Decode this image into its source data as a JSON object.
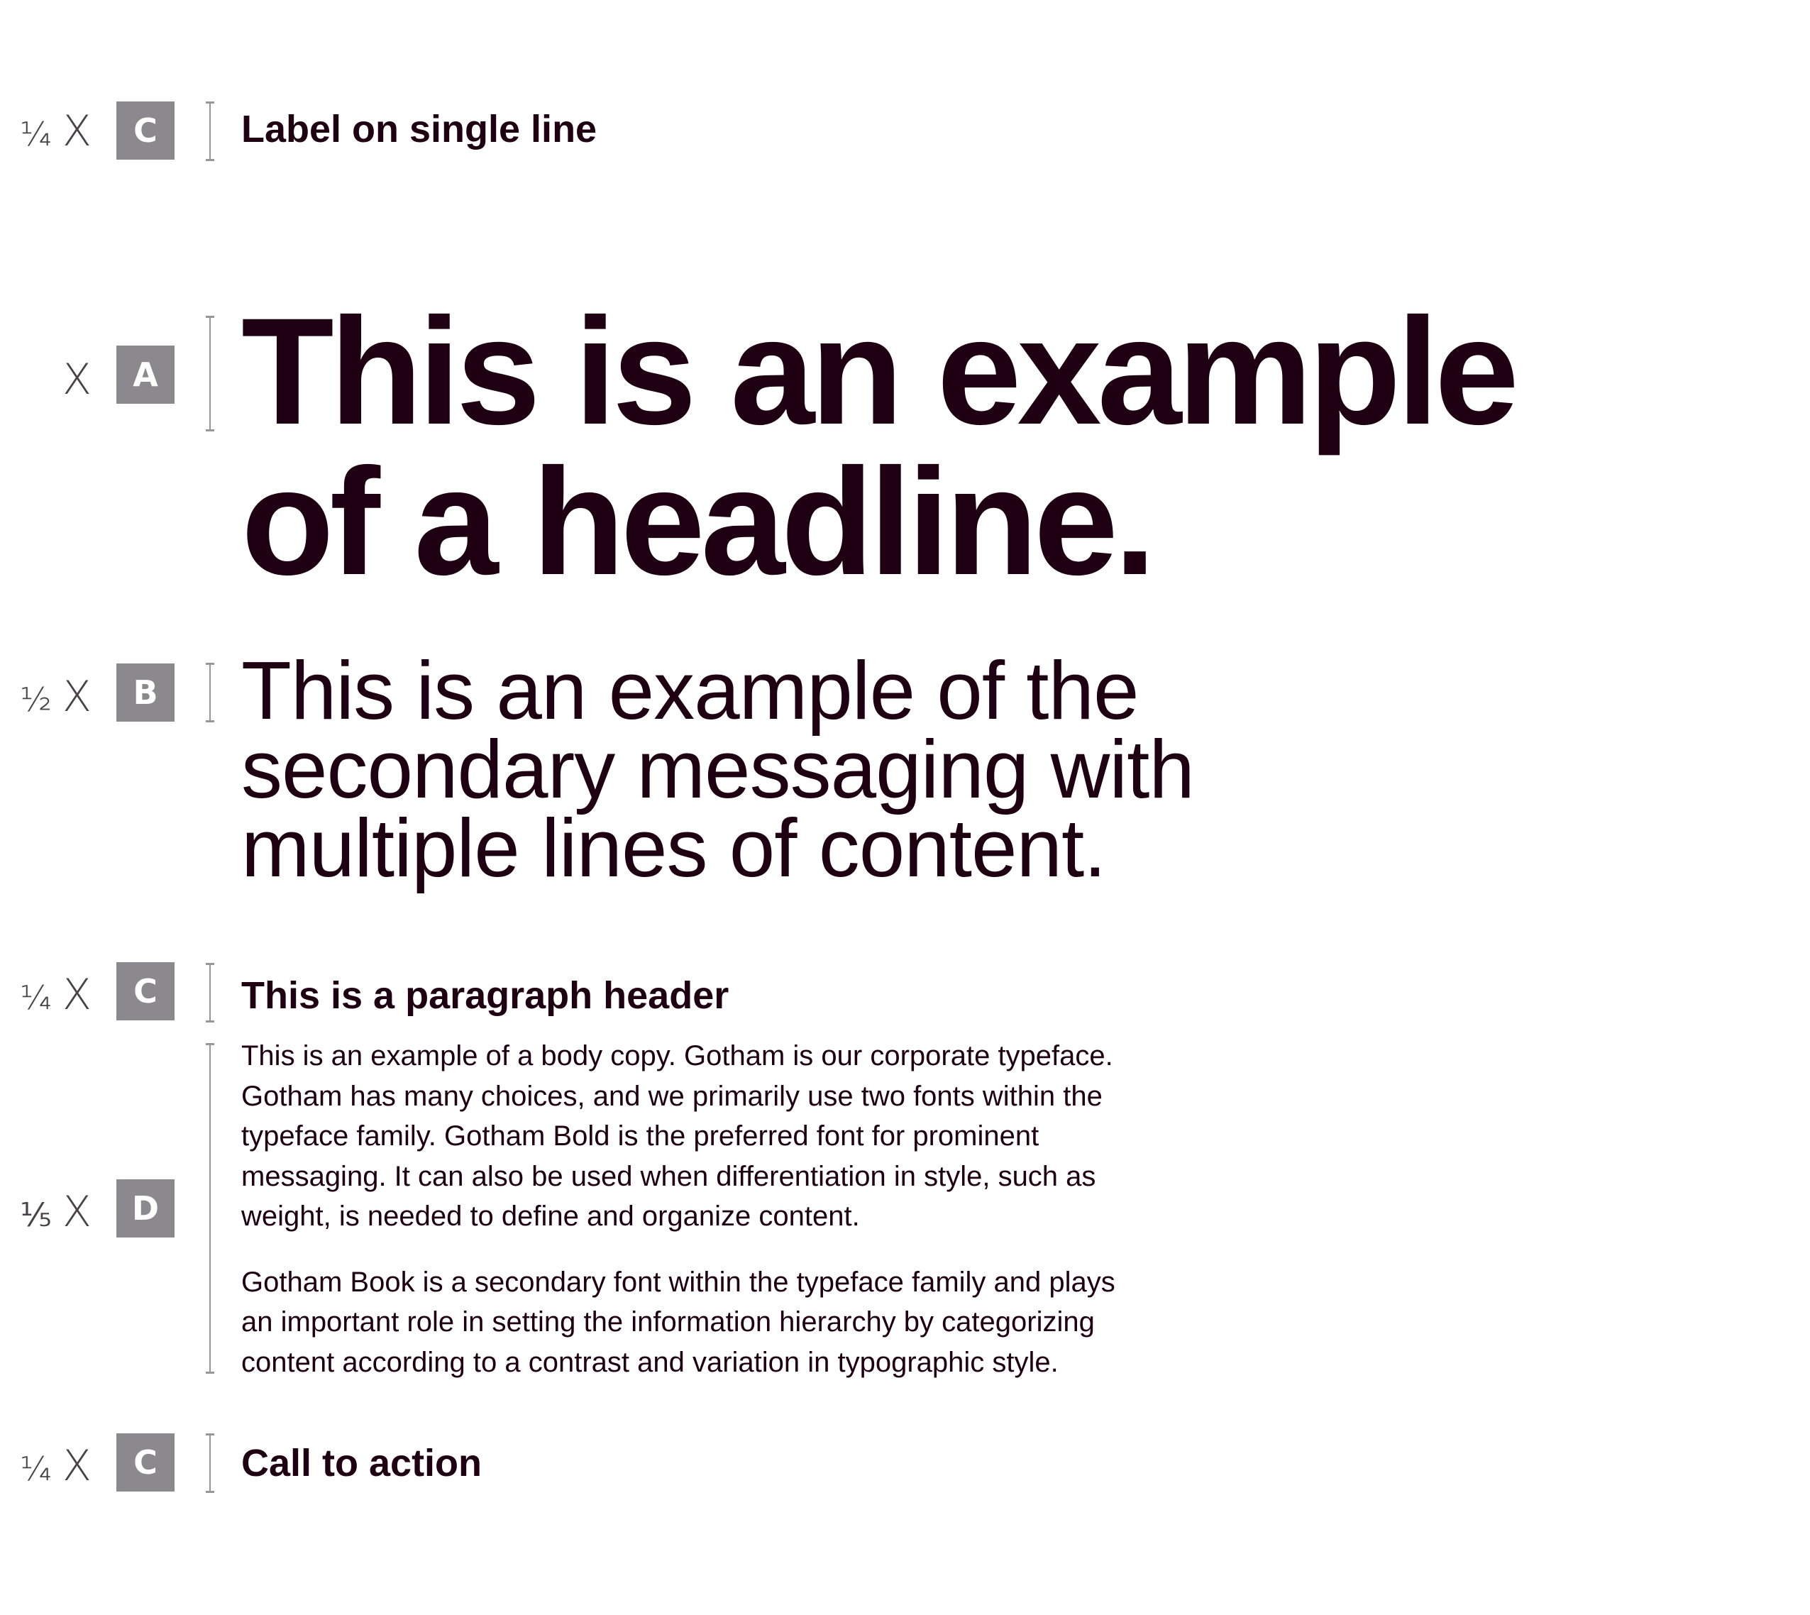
{
  "rows": [
    {
      "ratio": "¼",
      "multiplier": "X",
      "style_letter": "C",
      "text": "Label on single line"
    },
    {
      "ratio": "",
      "multiplier": "X",
      "style_letter": "A",
      "lines": [
        "This is an example",
        "of a headline."
      ]
    },
    {
      "ratio": "½",
      "multiplier": "X",
      "style_letter": "B",
      "lines": [
        "This is an example of the",
        "secondary messaging with",
        "multiple lines of content."
      ]
    },
    {
      "ratio": "¼",
      "multiplier": "X",
      "style_letter": "C",
      "text": "This is a paragraph header"
    },
    {
      "ratio": "⅕",
      "multiplier": "X",
      "style_letter": "D",
      "paragraphs": [
        [
          "This is an example of a body copy. Gotham is our corporate typeface.",
          "Gotham has many choices, and we primarily use two fonts within the",
          "typeface family. Gotham Bold is the preferred font for prominent",
          "messaging. It can also be used when differentiation in style, such as",
          "weight, is needed to define and organize content."
        ],
        [
          "Gotham Book is a secondary font within the typeface family and plays",
          "an important role in setting the information hierarchy by categorizing",
          "content according to a contrast and variation in typographic style."
        ]
      ]
    },
    {
      "ratio": "¼",
      "multiplier": "X",
      "style_letter": "C",
      "text": "Call to action"
    }
  ],
  "colors": {
    "text": "#1e0012",
    "badge": "#8c898e",
    "ratio_text": "#4a4248",
    "bracket": "#9a979c"
  }
}
